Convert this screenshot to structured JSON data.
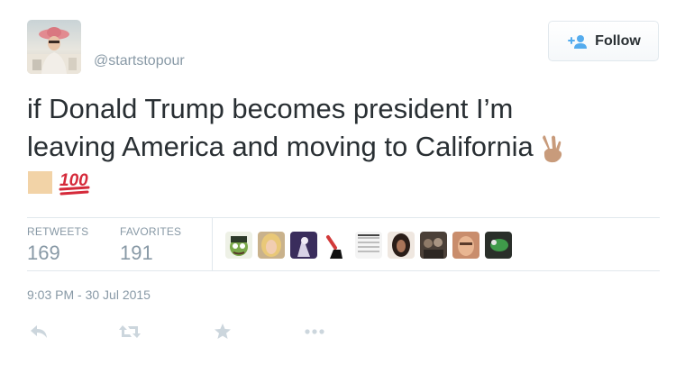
{
  "user": {
    "handle": "@startstopour",
    "avatar_icon": "profile-photo"
  },
  "follow_button": {
    "label": "Follow",
    "icon": "add-user-icon",
    "accent_color": "#55acee"
  },
  "tweet": {
    "line1": "if Donald Trump becomes president I’m",
    "line2": "leaving America and moving to California",
    "emojis": [
      "victory-hand-emoji",
      "skin-tone-swatch",
      "hundred-points-emoji"
    ]
  },
  "stats": {
    "retweets_label": "RETWEETS",
    "retweets_count": "169",
    "favorites_label": "FAVORITES",
    "favorites_count": "191"
  },
  "favoriters": [
    "frog-avatar",
    "blonde-woman-avatar",
    "purple-figure-avatar",
    "hand-raised-avatar",
    "text-grid-avatar",
    "dark-hair-avatar",
    "group-photo-avatar",
    "girl-selfie-avatar",
    "green-figure-avatar"
  ],
  "timestamp": "9:03 PM - 30 Jul 2015",
  "actions": [
    "reply-icon",
    "retweet-icon",
    "favorite-icon",
    "more-icon"
  ]
}
